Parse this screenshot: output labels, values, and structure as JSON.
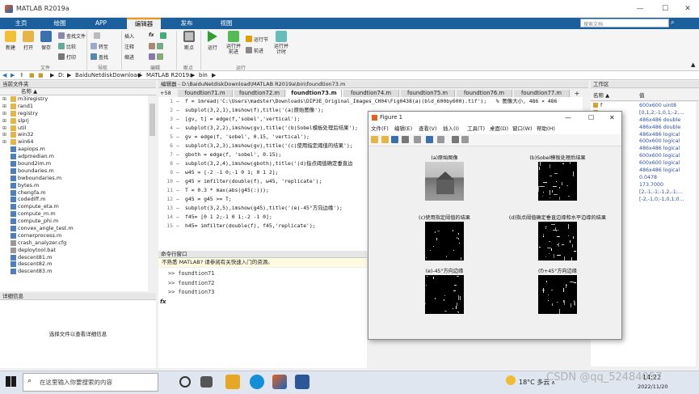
{
  "app": {
    "title": "MATLAB R2019a",
    "search_placeholder": "搜索文档"
  },
  "main_tabs": [
    "主页",
    "绘图",
    "APP",
    "编辑器",
    "发布",
    "视图"
  ],
  "toolbar": {
    "new": "新建",
    "open": "打开",
    "save": "保存",
    "find_files": "查找文件",
    "compare": "比较",
    "print": "打印",
    "insert": "插入",
    "comment": "注释",
    "indent": "缩进",
    "fx": "fx",
    "goto": "转至",
    "find": "查找",
    "breakpoint": "断点",
    "run": "运行",
    "run_advance": "运行并\n前进",
    "run_section": "运行节",
    "advance": "前进",
    "run_time": "运行并\n计时",
    "groups": [
      "文件",
      "导航",
      "编辑",
      "断点",
      "运行"
    ]
  },
  "address": {
    "path": [
      "D:",
      "BaiduNetdiskDownload",
      "MATLAB R2019a",
      "bin"
    ]
  },
  "current_folder": {
    "title": "当前文件夹",
    "col_name": "名称 ▲",
    "items": [
      "m3iregistry",
      "rand1",
      "registry",
      "slprj",
      "util",
      "win32",
      "win64",
      "aapiops.m",
      "adpmedian.m",
      "bound2im.m",
      "boundaries.m",
      "bwboundaries.m",
      "bytes.m",
      "chengfa.m",
      "codediff.m",
      "compute_eta.m",
      "compute_m.m",
      "compute_phi.m",
      "convex_angle_test.m",
      "cornerprocess.m",
      "crash_analyzer.cfg",
      "deploytool.bat",
      "descent81.m",
      "descent82.m",
      "descent83.m"
    ]
  },
  "details": {
    "title": "详细信息",
    "hint": "选择文件以查看详细信息"
  },
  "editor": {
    "title": "编辑器 - D:\\BaiduNetdiskDownload\\MATLAB R2019a\\bin\\foundtion73.m",
    "tabs": [
      "foundtion71.m",
      "foundtion72.m",
      "foundtion73.m",
      "foundtion74.m",
      "foundtion75.m",
      "foundtion76.m",
      "foundtion77.m"
    ],
    "lines": [
      "f = imread('C:\\Users\\madster\\Downloads\\DIP3E_Original_Images_CH04\\Fig0438(a)(bld_600by600).tif');   % 图像大小, 486 × 486",
      "subplot(3,2,1),imshow(f),title('(a)原始图像');",
      "[gv, t] = edge(f,'sobel','vertical');",
      "subplot(3,2,2),imshow(gv),title('(b)Sobel模板处理后结果');",
      "gv = edge(f, 'sobel', 0.15, 'vertical');",
      "subplot(3,2,3),imshow(gv),title('(c)使用指定阈值的结果');",
      "gboth = edge(f, 'sobel', 0.15);",
      "subplot(3,2,4),imshow(gboth),title('(d)指点阈值确定垂直边",
      "w45 = [-2 -1 0;-1 0 1; 0 1 2];",
      "g45 = imfilter(double(f), w45, 'replicate');",
      "T = 0.3 * max(abs(g45(:)));",
      "g45 = g45 >= T;",
      "subplot(3,2,5),imshow(g45),title('(e)-45°方向边缘');",
      "f45= [0 1 2;-1 0 1;-2 -1 0];",
      "h45= imfilter(double(f), f45,'replicate');"
    ]
  },
  "command": {
    "title": "命令行窗口",
    "notice": "不熟悉 MATLAB? 请参阅有关快速入门的资源。",
    "history": [
      ">> foundtion71",
      ">> foundtion72",
      ">> foundtion73"
    ],
    "prompt": "fx"
  },
  "workspace": {
    "title": "工作区",
    "col_name": "名称 ▲",
    "col_value": "值",
    "rows": [
      [
        "f",
        "600x600 uint8"
      ],
      [
        "",
        "[0,1,2;-1,0,1;-2,..."
      ],
      [
        "",
        "486x486 double"
      ],
      [
        "",
        "486x486 double"
      ],
      [
        "",
        "486x486 logical"
      ],
      [
        "",
        "600x600 logical"
      ],
      [
        "",
        "486x486 logical"
      ],
      [
        "",
        "600x600 logical"
      ],
      [
        "",
        "600x600 logical"
      ],
      [
        "",
        "486x486 logical"
      ],
      [
        "",
        "0.0478"
      ],
      [
        "",
        "173.7000"
      ],
      [
        "",
        "[2,-1,-1;-1,2,-1;..."
      ],
      [
        "",
        "[-2,-1,0;-1,0,1;0..."
      ]
    ]
  },
  "figure": {
    "title": "Figure 1",
    "menus": [
      "文件(F)",
      "编辑(E)",
      "查看(V)",
      "插入(I)",
      "工具(T)",
      "桌面(D)",
      "窗口(W)",
      "帮助(H)"
    ],
    "subplots": [
      "(a)原始图像",
      "(b)Sobel模板处理后结果",
      "(c)使用指定阈值的结果",
      "(d)指点阈值确定垂直边缘和水平边缘的结果",
      "(e)-45°方向边缘",
      "(f)+45°方向边缘"
    ]
  },
  "taskbar": {
    "search": "在这里输入你要搜索的内容",
    "weather": "18°C 多云",
    "time": "14:22",
    "date": "2022/11/20",
    "watermark": "CSDN @qq_52484057"
  },
  "colors": {
    "tab_bar": "#1b5f9c",
    "active_tab_accent": "#e79c16",
    "link": "#2c4fa8"
  }
}
